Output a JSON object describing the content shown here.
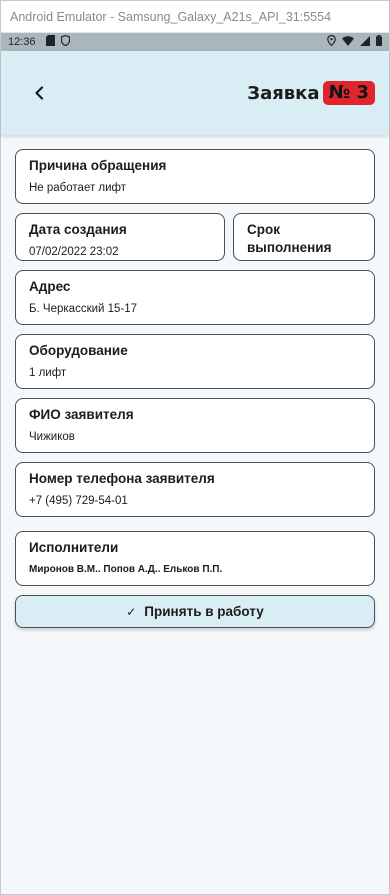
{
  "window": {
    "title": "Android Emulator - Samsung_Galaxy_A21s_API_31:5554"
  },
  "statusbar": {
    "time": "12:36"
  },
  "header": {
    "title": "Заявка",
    "badge": "№ 3"
  },
  "fields": {
    "reason": {
      "label": "Причина обращения",
      "value": "Не работает лифт"
    },
    "created": {
      "label": "Дата создания",
      "value": "07/02/2022 23:02"
    },
    "deadline": {
      "label": "Срок выполнения",
      "value": ""
    },
    "address": {
      "label": "Адрес",
      "value": "Б. Черкасский 15-17"
    },
    "equipment": {
      "label": "Оборудование",
      "value": "1 лифт"
    },
    "applicant": {
      "label": "ФИО заявителя",
      "value": "Чижиков"
    },
    "phone": {
      "label": "Номер телефона заявителя",
      "value": "+7 (495) 729-54-01"
    },
    "executors": {
      "label": "Исполнители",
      "value": "Миронов В.М.. Попов А.Д.. Ельков П.П."
    }
  },
  "actions": {
    "accept_label": "Принять в работу"
  },
  "colors": {
    "accent": "#d9edf4",
    "badge": "#e0262d",
    "border": "#4b4f54"
  }
}
